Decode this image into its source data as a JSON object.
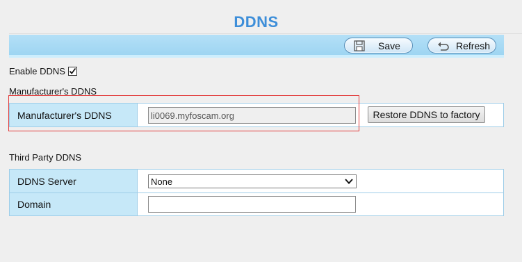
{
  "page": {
    "title": "DDNS"
  },
  "toolbar": {
    "save_label": "Save",
    "refresh_label": "Refresh",
    "save_icon": "floppy-disk-icon",
    "refresh_icon": "undo-arrow-icon"
  },
  "enable_ddns": {
    "label": "Enable DDNS",
    "checked": true
  },
  "manufacturer_section": {
    "heading": "Manufacturer's DDNS",
    "row_label": "Manufacturer's DDNS",
    "value": "li0069.myfoscam.org",
    "restore_label": "Restore DDNS to factory"
  },
  "third_party_section": {
    "heading": "Third Party DDNS",
    "server_label": "DDNS Server",
    "server_value": "None",
    "domain_label": "Domain",
    "domain_value": ""
  },
  "colors": {
    "title": "#3d8ed9",
    "toolbar": "#a8d9f4",
    "row_label_bg": "#c6e8f8",
    "highlight": "#e23a3a"
  }
}
